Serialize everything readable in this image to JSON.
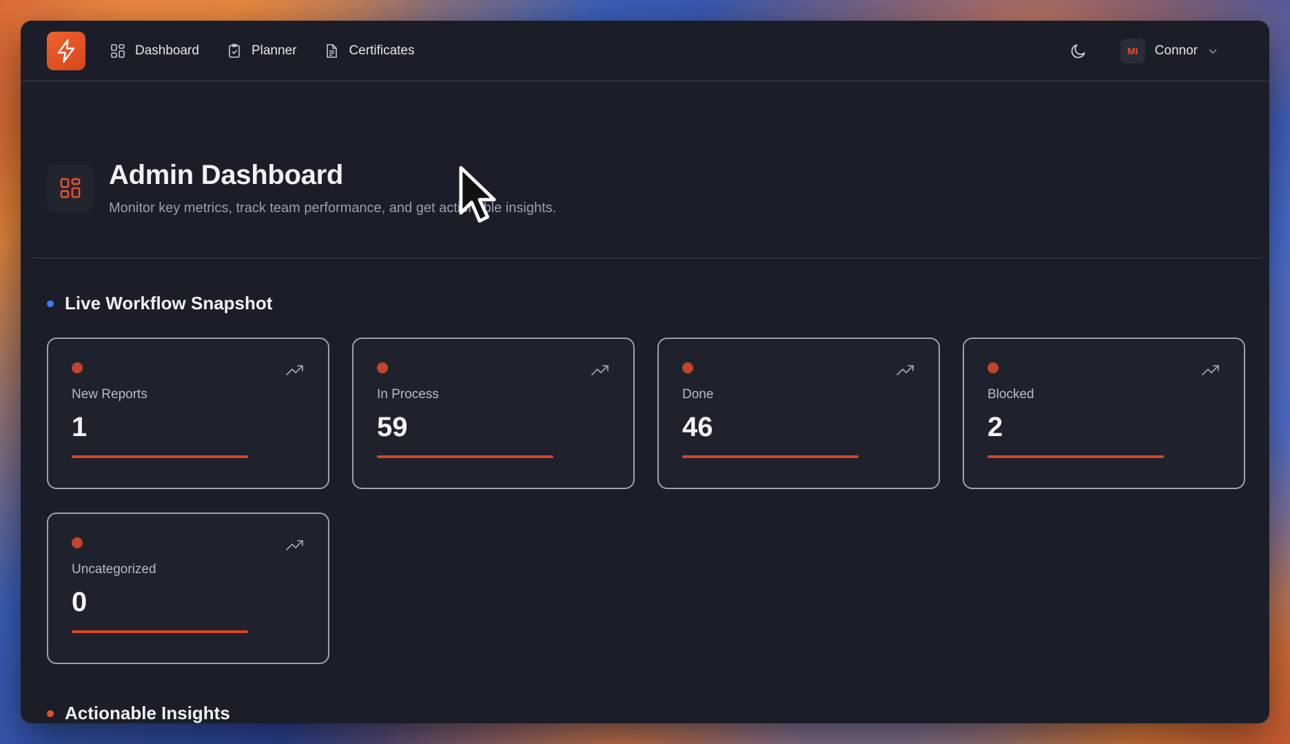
{
  "nav": {
    "items": [
      {
        "label": "Dashboard",
        "icon": "grid-icon"
      },
      {
        "label": "Planner",
        "icon": "clipboard-icon"
      },
      {
        "label": "Certificates",
        "icon": "document-icon"
      }
    ],
    "user": {
      "initials": "MI",
      "name": "Connor"
    }
  },
  "header": {
    "title": "Admin Dashboard",
    "subtitle": "Monitor key metrics, track team performance, and get actionable insights."
  },
  "sections": {
    "snapshot": {
      "title": "Live Workflow Snapshot",
      "dot_color": "#3b7bf0"
    },
    "insights": {
      "title": "Actionable Insights",
      "dot_color": "#e4512b"
    }
  },
  "cards": [
    {
      "label": "New Reports",
      "value": "1",
      "progress": 1.0
    },
    {
      "label": "In Process",
      "value": "59",
      "progress": 1.0
    },
    {
      "label": "Done",
      "value": "46",
      "progress": 1.0
    },
    {
      "label": "Blocked",
      "value": "2",
      "progress": 1.0
    },
    {
      "label": "Uncategorized",
      "value": "0",
      "progress": 1.0
    }
  ],
  "colors": {
    "accent": "#e4512b",
    "background": "#1b1e28"
  }
}
